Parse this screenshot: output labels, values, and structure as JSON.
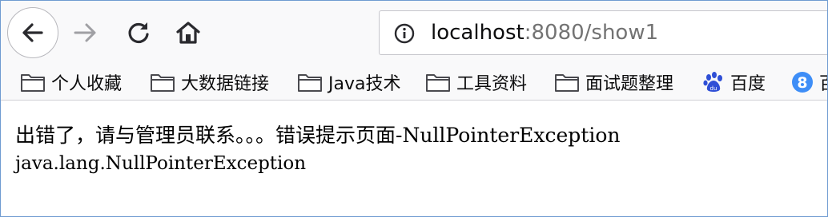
{
  "url": {
    "host": "localhost",
    "rest": ":8080/show1"
  },
  "bookmarks": [
    {
      "label": "个人收藏",
      "icon": "folder-icon"
    },
    {
      "label": "大数据链接",
      "icon": "folder-icon"
    },
    {
      "label": "Java技术",
      "icon": "folder-icon"
    },
    {
      "label": "工具资料",
      "icon": "folder-icon"
    },
    {
      "label": "面试题整理",
      "icon": "folder-icon"
    },
    {
      "label": "百度",
      "icon": "baidu-paw-icon"
    },
    {
      "label": "百",
      "icon": "blue-8-circle-icon"
    }
  ],
  "page": {
    "line1": "出错了，请与管理员联系。。。错误提示页面-NullPointerException",
    "line2": "java.lang.NullPointerException"
  },
  "colors": {
    "baidu_blue": "#2f4fd6",
    "bookmark_8_blue": "#3e8ef7",
    "window_border": "#6f9bd1"
  }
}
